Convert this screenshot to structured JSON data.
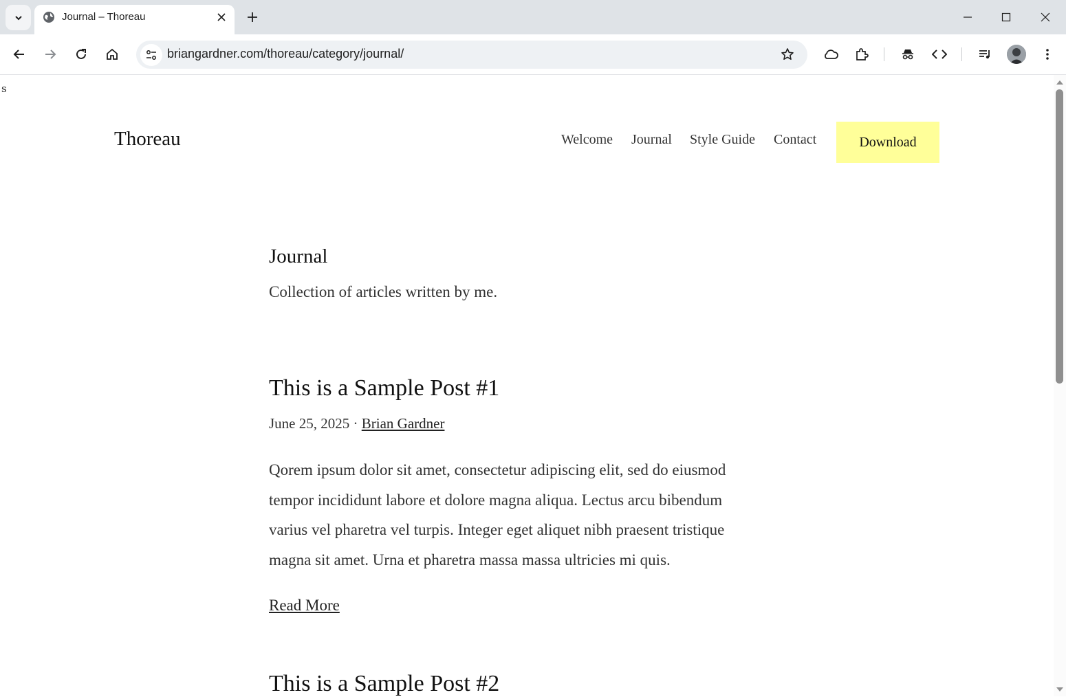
{
  "browser": {
    "tab_title": "Journal – Thoreau",
    "url": "briangardner.com/thoreau/category/journal/",
    "icons": [
      "tab-list-icon",
      "globe-icon",
      "close-icon",
      "plus-icon",
      "minimize-icon",
      "maximize-icon",
      "window-close-icon",
      "back-icon",
      "forward-icon",
      "reload-icon",
      "home-icon",
      "site-info-icon",
      "star-icon",
      "cloud-icon",
      "extensions-icon",
      "incognito-spy-icon",
      "code-icon",
      "media-queue-icon",
      "profile-avatar",
      "more-vert-icon"
    ]
  },
  "page": {
    "stray_text": "s",
    "site_title": "Thoreau",
    "nav": [
      "Welcome",
      "Journal",
      "Style Guide",
      "Contact"
    ],
    "download_label": "Download",
    "archive_title": "Journal",
    "archive_description": "Collection of articles written by me.",
    "posts": [
      {
        "title": "This is a Sample Post #1",
        "date": "June 25, 2025",
        "separator": "·",
        "author": "Brian Gardner",
        "excerpt": "Qorem ipsum dolor sit amet, consectetur adipiscing elit, sed do eiusmod tempor incididunt labore et dolore magna aliqua. Lectus arcu bibendum varius vel pharetra vel turpis. Integer eget aliquet nibh praesent tristique magna sit amet. Urna et pharetra massa massa ultricies mi quis.",
        "read_more": "Read More"
      },
      {
        "title": "This is a Sample Post #2"
      }
    ]
  },
  "colors": {
    "download_bg": "#ffff99",
    "tabstrip_bg": "#dfe3e7",
    "omnibox_bg": "#eef1f4"
  }
}
